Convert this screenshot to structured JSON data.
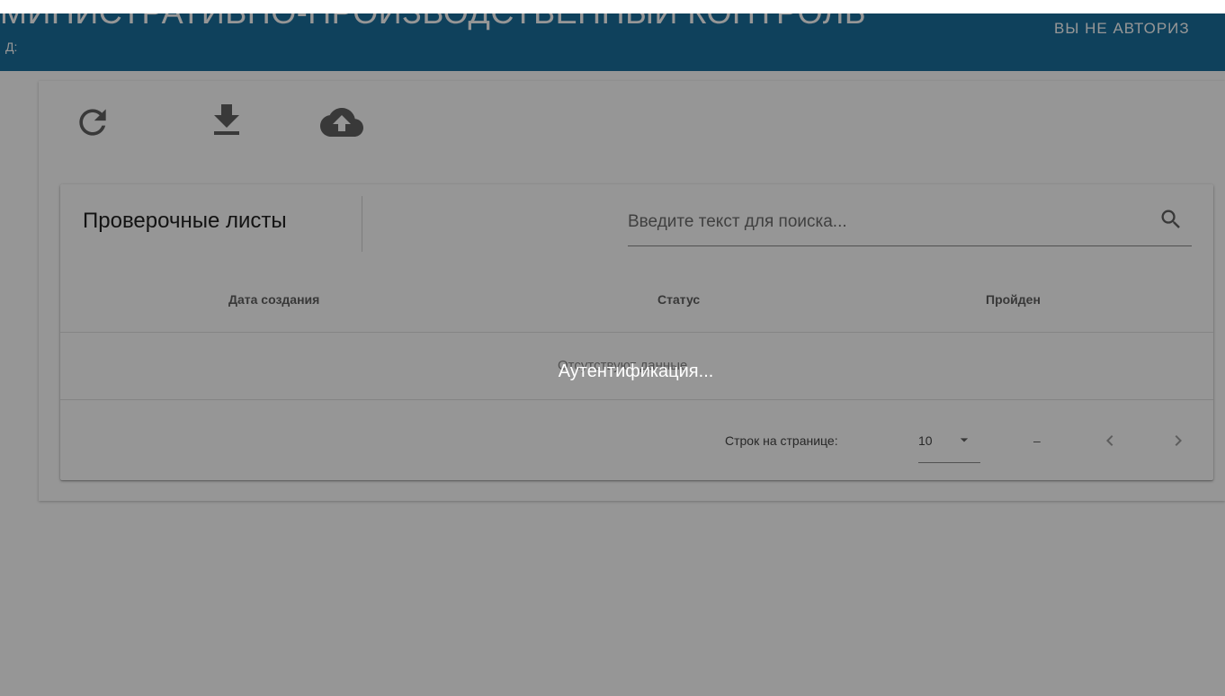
{
  "header": {
    "title": "МИНИСТРАТИВНО-ПРОИЗВОДСТВЕННЫЙ КОНТРОЛЬ",
    "subtitle": "Д:",
    "user_status": "ВЫ НЕ АВТОРИЗ",
    "background_color": "#1a6f9d"
  },
  "toolbar": {
    "buttons": [
      {
        "icon": "refresh-icon"
      },
      {
        "icon": "download-icon"
      },
      {
        "icon": "cloud-upload-icon"
      }
    ]
  },
  "table": {
    "title": "Проверочные листы",
    "search": {
      "placeholder": "Введите текст для поиска...",
      "value": "",
      "icon": "search-icon"
    },
    "columns": [
      "Дата создания",
      "Статус",
      "Пройден"
    ],
    "rows": [],
    "empty_text": "Отсутствуют данные",
    "pagination": {
      "rows_per_page_label": "Строк на странице:",
      "rows_per_page_value": "10",
      "range_text": "–",
      "prev_icon": "chevron-left-icon",
      "next_icon": "chevron-right-icon"
    }
  },
  "overlay": {
    "message": "Аутентификация...",
    "color": "rgba(0,0,0,0.41)"
  }
}
